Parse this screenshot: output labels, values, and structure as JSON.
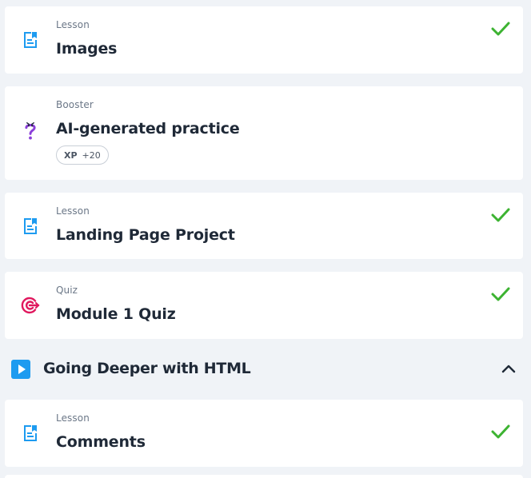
{
  "items": [
    {
      "kind": "Lesson",
      "title": "Images",
      "icon": "lesson-document-icon",
      "completed": true
    },
    {
      "kind": "Booster",
      "title": "AI-generated practice",
      "icon": "question-mark-icon",
      "completed": false,
      "badge": {
        "label": "XP",
        "value": "+20"
      }
    },
    {
      "kind": "Lesson",
      "title": "Landing Page Project",
      "icon": "lesson-document-icon",
      "completed": true
    },
    {
      "kind": "Quiz",
      "title": "Module 1 Quiz",
      "icon": "target-icon",
      "completed": true
    }
  ],
  "section": {
    "title": "Going Deeper with HTML",
    "icon": "play-icon",
    "expanded": true
  },
  "section_items": [
    {
      "kind": "Lesson",
      "title": "Comments",
      "icon": "lesson-document-icon",
      "completed": true
    }
  ],
  "colors": {
    "background": "#f0f3f7",
    "card": "#ffffff",
    "lesson_icon": "#1d9bf0",
    "check": "#3db332",
    "booster_icon": "#8b3fd9",
    "quiz_icon": "#e0185e",
    "play_button": "#1d9bf0"
  }
}
